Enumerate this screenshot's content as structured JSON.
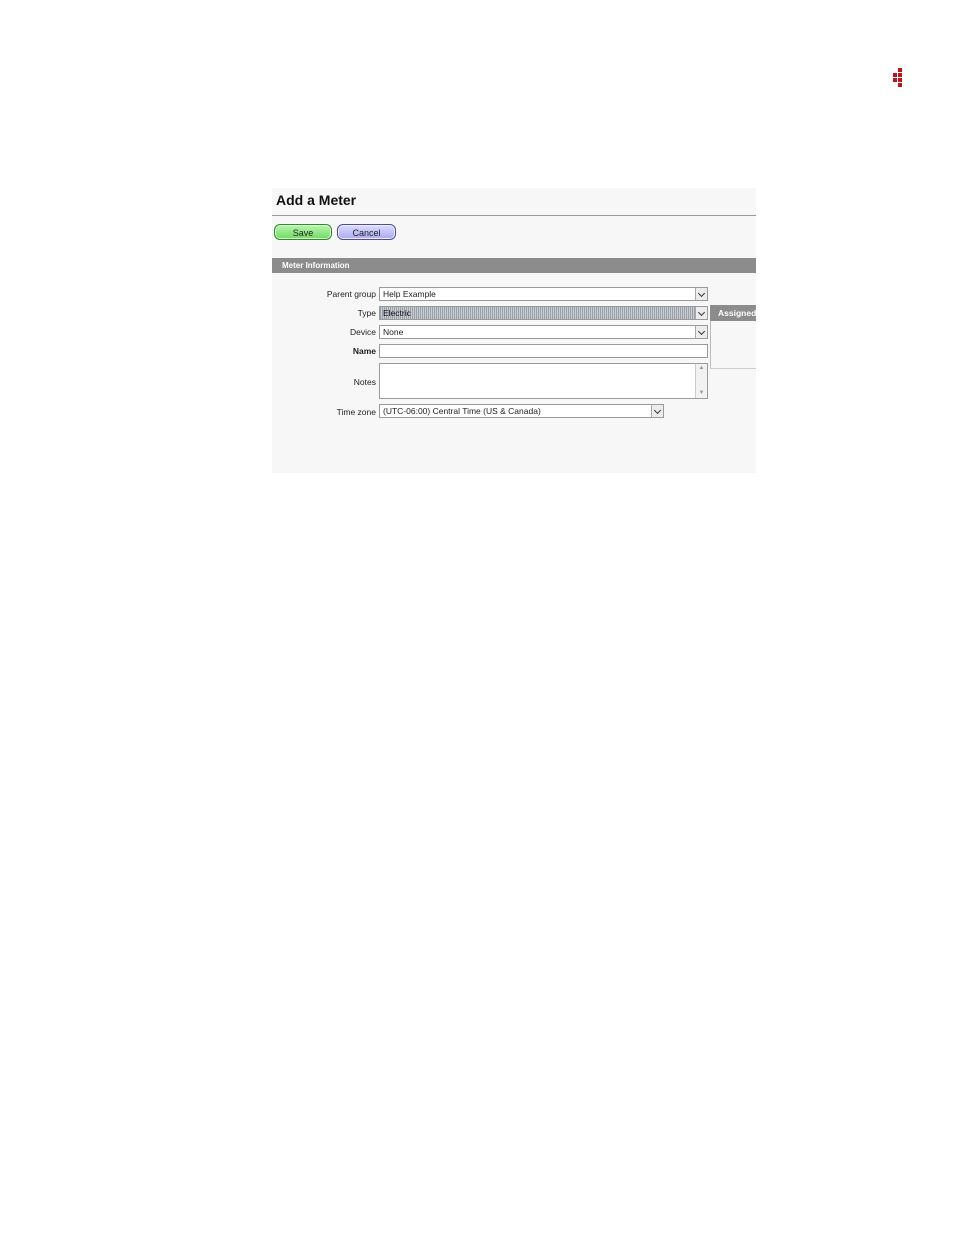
{
  "form": {
    "title": "Add a Meter",
    "buttons": {
      "save": "Save",
      "cancel": "Cancel"
    },
    "section": "Meter Information",
    "fields": {
      "parent_group": {
        "label": "Parent group",
        "value": "Help Example"
      },
      "type": {
        "label": "Type",
        "value": "Electric"
      },
      "device": {
        "label": "Device",
        "value": "None"
      },
      "name": {
        "label": "Name",
        "value": ""
      },
      "notes": {
        "label": "Notes",
        "value": ""
      },
      "time_zone": {
        "label": "Time zone",
        "value": "(UTC-06:00) Central Time (US & Canada)"
      }
    },
    "assigned_tab": "Assigned"
  },
  "colors": {
    "logo": "#c0141c",
    "save": "#6fdc62",
    "cancel": "#a9a9f0",
    "bar": "#8c8c8c"
  }
}
